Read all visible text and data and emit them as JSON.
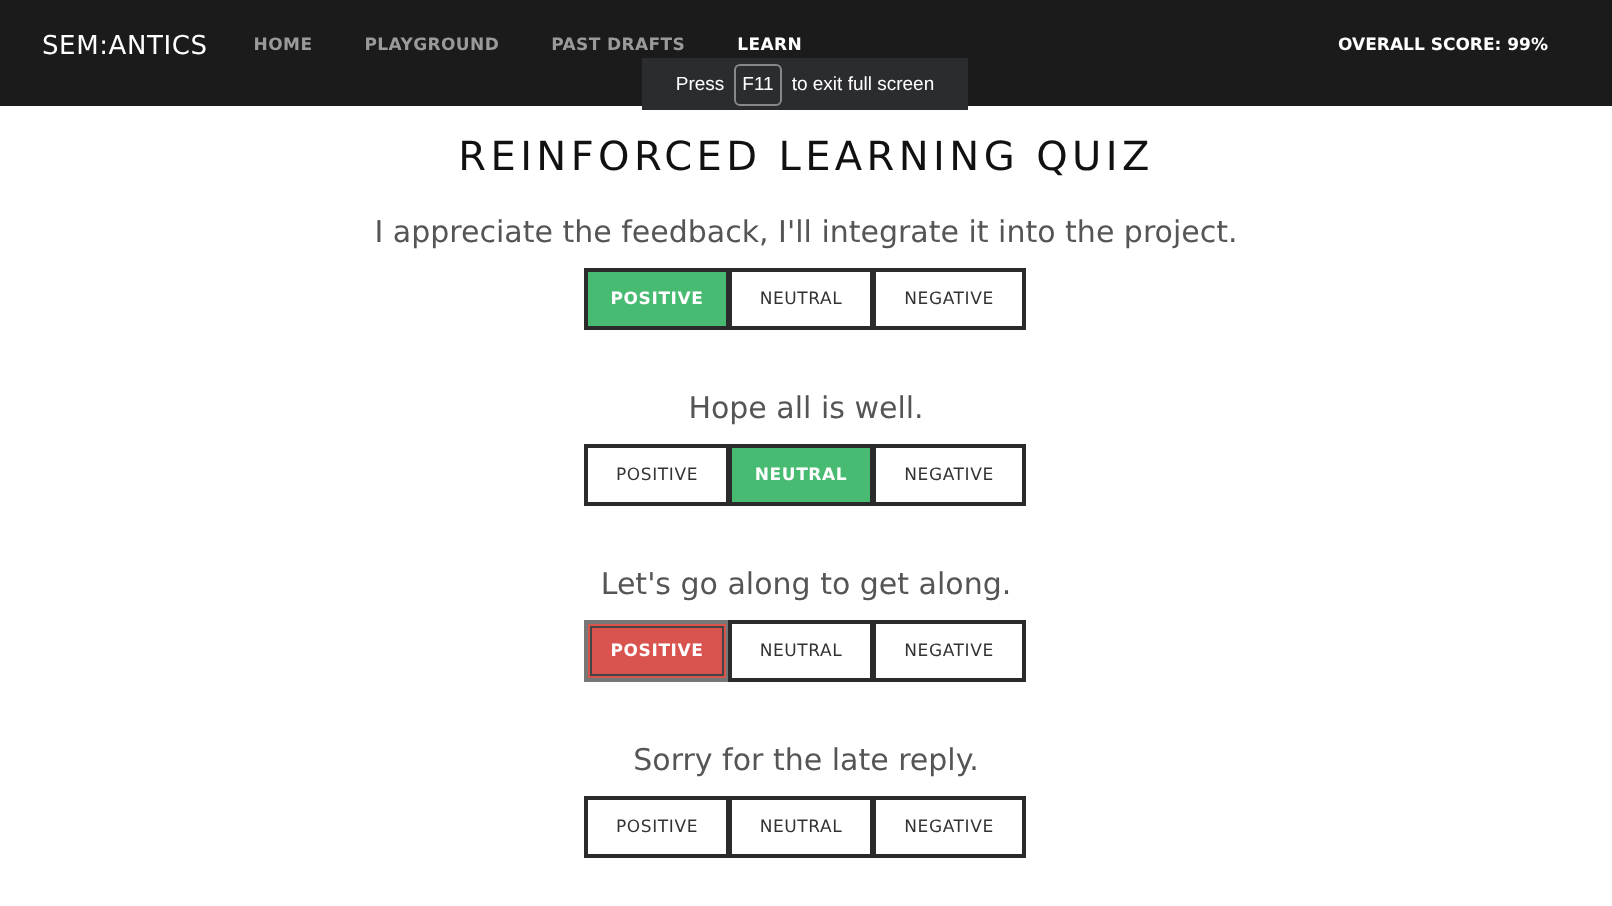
{
  "nav": {
    "brand": "SEM:ANTICS",
    "links": [
      {
        "label": "HOME",
        "selected": false
      },
      {
        "label": "PLAYGROUND",
        "selected": false
      },
      {
        "label": "PAST DRAFTS",
        "selected": false
      },
      {
        "label": "LEARN",
        "selected": true
      }
    ],
    "score": "OVERALL SCORE: 99%"
  },
  "fullscreen_notice": {
    "before": "Press",
    "key": "F11",
    "after": "to exit full screen"
  },
  "title": "REINFORCED LEARNING QUIZ",
  "questions": [
    {
      "text": "I appreciate the feedback, I'll integrate it into the project.",
      "kind": "correct",
      "options": [
        {
          "label": "POSITIVE",
          "selected": true,
          "focused": false
        },
        {
          "label": "NEUTRAL",
          "selected": false,
          "focused": false
        },
        {
          "label": "NEGATIVE",
          "selected": false,
          "focused": false
        }
      ]
    },
    {
      "text": "Hope all is well.",
      "kind": "correct",
      "options": [
        {
          "label": "POSITIVE",
          "selected": false,
          "focused": false
        },
        {
          "label": "NEUTRAL",
          "selected": true,
          "focused": false
        },
        {
          "label": "NEGATIVE",
          "selected": false,
          "focused": false
        }
      ]
    },
    {
      "text": "Let's go along to get along.",
      "kind": "wrong",
      "options": [
        {
          "label": "POSITIVE",
          "selected": true,
          "focused": true
        },
        {
          "label": "NEUTRAL",
          "selected": false,
          "focused": false
        },
        {
          "label": "NEGATIVE",
          "selected": false,
          "focused": false
        }
      ]
    },
    {
      "text": "Sorry for the late reply.",
      "options": [
        {
          "label": "POSITIVE",
          "selected": false,
          "focused": false
        },
        {
          "label": "NEUTRAL",
          "selected": false,
          "focused": false
        },
        {
          "label": "NEGATIVE",
          "selected": false,
          "focused": false
        }
      ]
    }
  ]
}
